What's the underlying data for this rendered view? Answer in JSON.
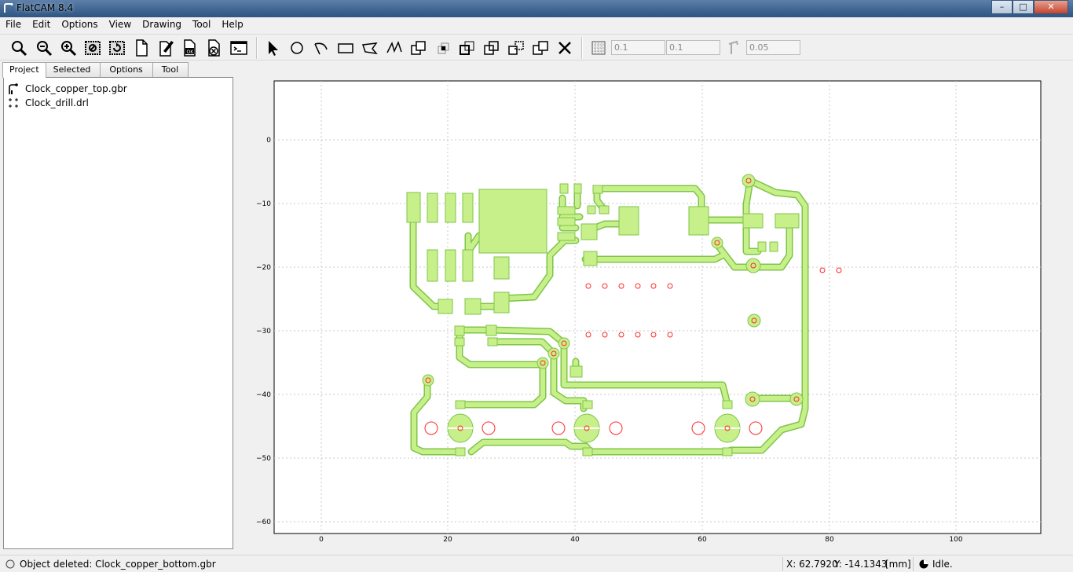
{
  "window": {
    "title": "FlatCAM 8.4",
    "buttons": [
      "–",
      "□",
      "✕"
    ]
  },
  "menu": [
    "File",
    "Edit",
    "Options",
    "View",
    "Drawing",
    "Tool",
    "Help"
  ],
  "toolbar": {
    "icons": [
      "zoom-fit-icon",
      "zoom-out-icon",
      "zoom-in-icon",
      "clear-plot-icon",
      "replot-icon",
      "new-geometry-icon",
      "edit-geometry-icon",
      "update-geometry-icon",
      "delete-object-icon",
      "shell-icon",
      "select-icon",
      "circle-icon",
      "arc-icon",
      "rectangle-icon",
      "polygon-icon",
      "path-icon",
      "union-icon",
      "intersection-icon",
      "subtract-icon",
      "cut-icon",
      "move-icon",
      "copy-icon",
      "delete-shape-icon",
      "grid-snap-icon",
      "corner-snap-icon"
    ],
    "grid_x": "0.1",
    "grid_y": "0.1",
    "snap_max": "0.05"
  },
  "tabs": [
    "Project",
    "Selected",
    "Options",
    "Tool"
  ],
  "project": {
    "items": [
      {
        "label": "Clock_copper_top.gbr",
        "icon": "gerber-icon"
      },
      {
        "label": "Clock_drill.drl",
        "icon": "drill-icon"
      }
    ]
  },
  "plot": {
    "x_ticks": [
      "0",
      "20",
      "40",
      "60",
      "80",
      "100"
    ],
    "y_ticks": [
      "0",
      "−10",
      "−20",
      "−30",
      "−40",
      "−50",
      "−60"
    ],
    "copper_color": "#c7f08a",
    "copper_edge": "#7fc44a",
    "drill_color": "#ff2a2a"
  },
  "status": {
    "message": "Object deleted: Clock_copper_bottom.gbr",
    "x_label": "X: 62.7920",
    "y_label": "Y: -14.1343",
    "units": "[mm]",
    "state": "Idle."
  }
}
